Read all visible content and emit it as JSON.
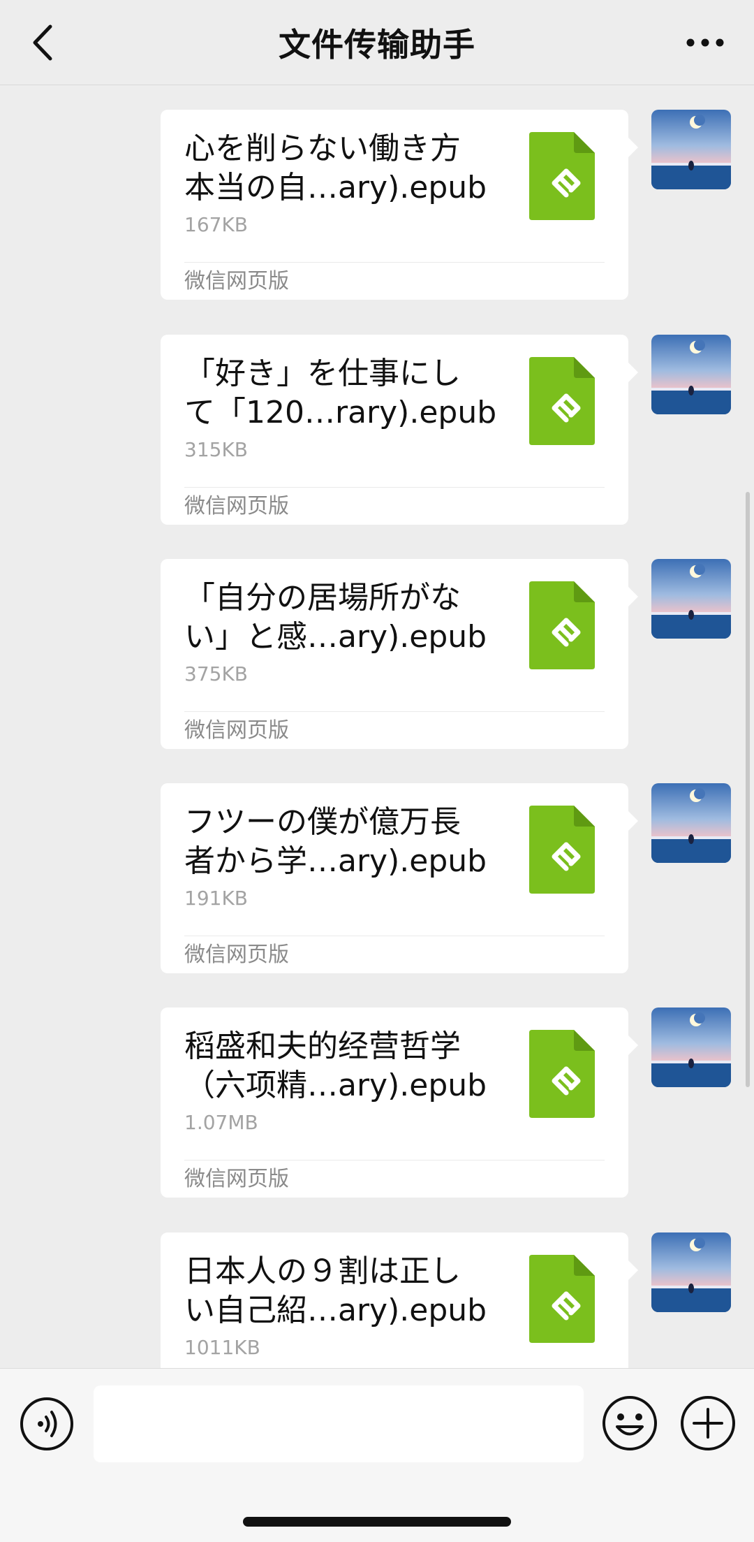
{
  "header": {
    "title": "文件传输助手",
    "back_icon": "chevron-left-icon",
    "more_icon": "more-dots-icon"
  },
  "messages": [
    {
      "name_line1": "心を削らない働き方",
      "name_line2": "本当の自…ary).epub",
      "size": "167KB",
      "source": "微信网页版"
    },
    {
      "name_line1": "「好き」を仕事にし",
      "name_line2": "て「120…rary).epub",
      "size": "315KB",
      "source": "微信网页版"
    },
    {
      "name_line1": "「自分の居場所がな",
      "name_line2": "い」と感…ary).epub",
      "size": "375KB",
      "source": "微信网页版"
    },
    {
      "name_line1": "フツーの僕が億万長",
      "name_line2": "者から学…ary).epub",
      "size": "191KB",
      "source": "微信网页版"
    },
    {
      "name_line1": "稻盛和夫的经营哲学",
      "name_line2": "（六项精…ary).epub",
      "size": "1.07MB",
      "source": "微信网页版"
    },
    {
      "name_line1": "日本人の９割は正し",
      "name_line2": "い自己紹…ary).epub",
      "size": "1011KB",
      "source": ""
    }
  ],
  "file_icon": {
    "name": "epub-file-icon",
    "color": "#7bbf1d"
  },
  "input_bar": {
    "placeholder": "",
    "voice_icon": "voice-icon",
    "emoji_icon": "emoji-icon",
    "plus_icon": "plus-icon"
  },
  "colors": {
    "background": "#ededed",
    "bubble": "#ffffff",
    "accent_green": "#7bbf1d"
  }
}
